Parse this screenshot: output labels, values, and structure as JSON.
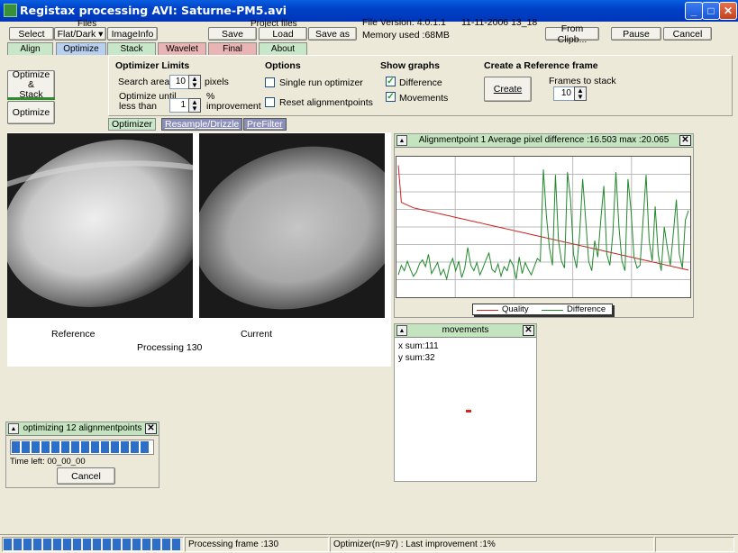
{
  "window": {
    "title": "Registax processing AVI: Saturne-PM5.avi"
  },
  "toolbar": {
    "select_label": "Select",
    "files_label": "Files",
    "flatdark_label": "Flat/Dark ▾",
    "imageinfo_label": "ImageInfo",
    "project_files_label": "Project files",
    "save_label": "Save",
    "load_label": "Load",
    "saveas_label": "Save as",
    "file_version": "File Version: 4.0.1.1",
    "file_date": "11-11-2006 13_18",
    "memory_used": "Memory used :68MB",
    "from_clipboard_label": "From Clipb...",
    "pause_label": "Pause",
    "cancel_label": "Cancel"
  },
  "tabs": [
    {
      "label": "Align",
      "color": "#c8e6c8"
    },
    {
      "label": "Optimize",
      "color": "#b8d0f0"
    },
    {
      "label": "Stack",
      "color": "#c8e6c8"
    },
    {
      "label": "Wavelet",
      "color": "#e8b4b4"
    },
    {
      "label": "Final",
      "color": "#e8b4b4"
    },
    {
      "label": "About",
      "color": "#c8e6c8"
    }
  ],
  "left_buttons": {
    "optimize_stack": "Optimize &\nStack",
    "optimize": "Optimize"
  },
  "optimizer_limits": {
    "heading": "Optimizer Limits",
    "search_area_label": "Search area",
    "search_area_value": "10",
    "pixels_label": "pixels",
    "optimize_until_label": "Optimize until\nless than",
    "optimize_until_value": "1",
    "improvement_label": "%\nimprovement"
  },
  "options": {
    "heading": "Options",
    "single_run_label": "Single run optimizer",
    "single_run_checked": false,
    "reset_label": "Reset alignmentpoints",
    "reset_checked": false
  },
  "show_graphs": {
    "heading": "Show graphs",
    "difference_label": "Difference",
    "difference_checked": true,
    "movements_label": "Movements",
    "movements_checked": true
  },
  "reference_frame": {
    "heading": "Create a Reference frame",
    "create_label": "Create",
    "frames_to_stack_label": "Frames to stack",
    "frames_to_stack_value": "10"
  },
  "subtabs": [
    "Optimizer",
    "Resample/Drizzle",
    "PreFilter"
  ],
  "images": {
    "reference_label": "Reference",
    "current_label": "Current",
    "processing_label": "Processing 130"
  },
  "graph_window": {
    "title": "Alignmentpoint 1 Average pixel difference :16.503 max :20.065",
    "legend_quality": "Quality",
    "legend_difference": "Difference",
    "quality_color": "#cc2222",
    "difference_color": "#22882c",
    "chart_data": {
      "type": "line",
      "series": [
        {
          "name": "Quality",
          "values": [
            95,
            68,
            67,
            66,
            65,
            64,
            63.5,
            63,
            62.5,
            62,
            61.5,
            61,
            60.5,
            60,
            59.5,
            59,
            58.5,
            58,
            57.5,
            57,
            56.5,
            56,
            55.5,
            55,
            54.5,
            54,
            53.5,
            53,
            52.5,
            52,
            51.5,
            51,
            50.5,
            50,
            49.5,
            49,
            48.5,
            48,
            47.5,
            47,
            46.5,
            46,
            45.5,
            45,
            44.5,
            44,
            43.5,
            43,
            42.5,
            42,
            41.5,
            41,
            40.5,
            40,
            39.5,
            39,
            38.5,
            38,
            37.5,
            37,
            36.5,
            36,
            35.5,
            35,
            34.5,
            34,
            33.5,
            33,
            32.5,
            32,
            31.5,
            31,
            30.5,
            30,
            29.5,
            29,
            28.5,
            28,
            27.5,
            27,
            26.5,
            26,
            25.5,
            25,
            24.5,
            24,
            23.5,
            23,
            22.5,
            22,
            21.5,
            21,
            20.5,
            20,
            19.5,
            19,
            18.5
          ]
        },
        {
          "name": "Difference",
          "values": [
            15,
            22,
            18,
            25,
            19,
            14,
            17,
            23,
            26,
            21,
            30,
            16,
            20,
            24,
            15,
            19,
            12,
            22,
            27,
            18,
            25,
            13,
            20,
            35,
            22,
            18,
            24,
            15,
            20,
            26,
            31,
            19,
            17,
            23,
            14,
            21,
            18,
            26,
            22,
            12,
            28,
            16,
            24,
            19,
            15,
            21,
            27,
            25,
            92,
            58,
            35,
            22,
            88,
            40,
            25,
            20,
            90,
            70,
            30,
            20,
            45,
            85,
            55,
            25,
            18,
            40,
            28,
            55,
            80,
            30,
            22,
            45,
            90,
            50,
            25,
            18,
            85,
            62,
            28,
            20,
            22,
            55,
            88,
            40,
            25,
            65,
            30,
            18,
            50,
            35,
            22,
            45,
            70,
            30,
            20,
            55,
            62
          ]
        }
      ],
      "ylim": [
        0,
        100
      ],
      "grid": true
    }
  },
  "movements_window": {
    "title": "movements",
    "x_sum": "x sum:111",
    "y_sum": "y sum:32"
  },
  "progress_window": {
    "title": "optimizing 12 alignmentpoints",
    "progress": 1.0,
    "time_left": "Time left: 00_00_00",
    "cancel_label": "Cancel"
  },
  "status": {
    "progress": 1.0,
    "processing_frame": "Processing frame :130",
    "optimizer_status": "Optimizer(n=97) : Last improvement :1%"
  }
}
